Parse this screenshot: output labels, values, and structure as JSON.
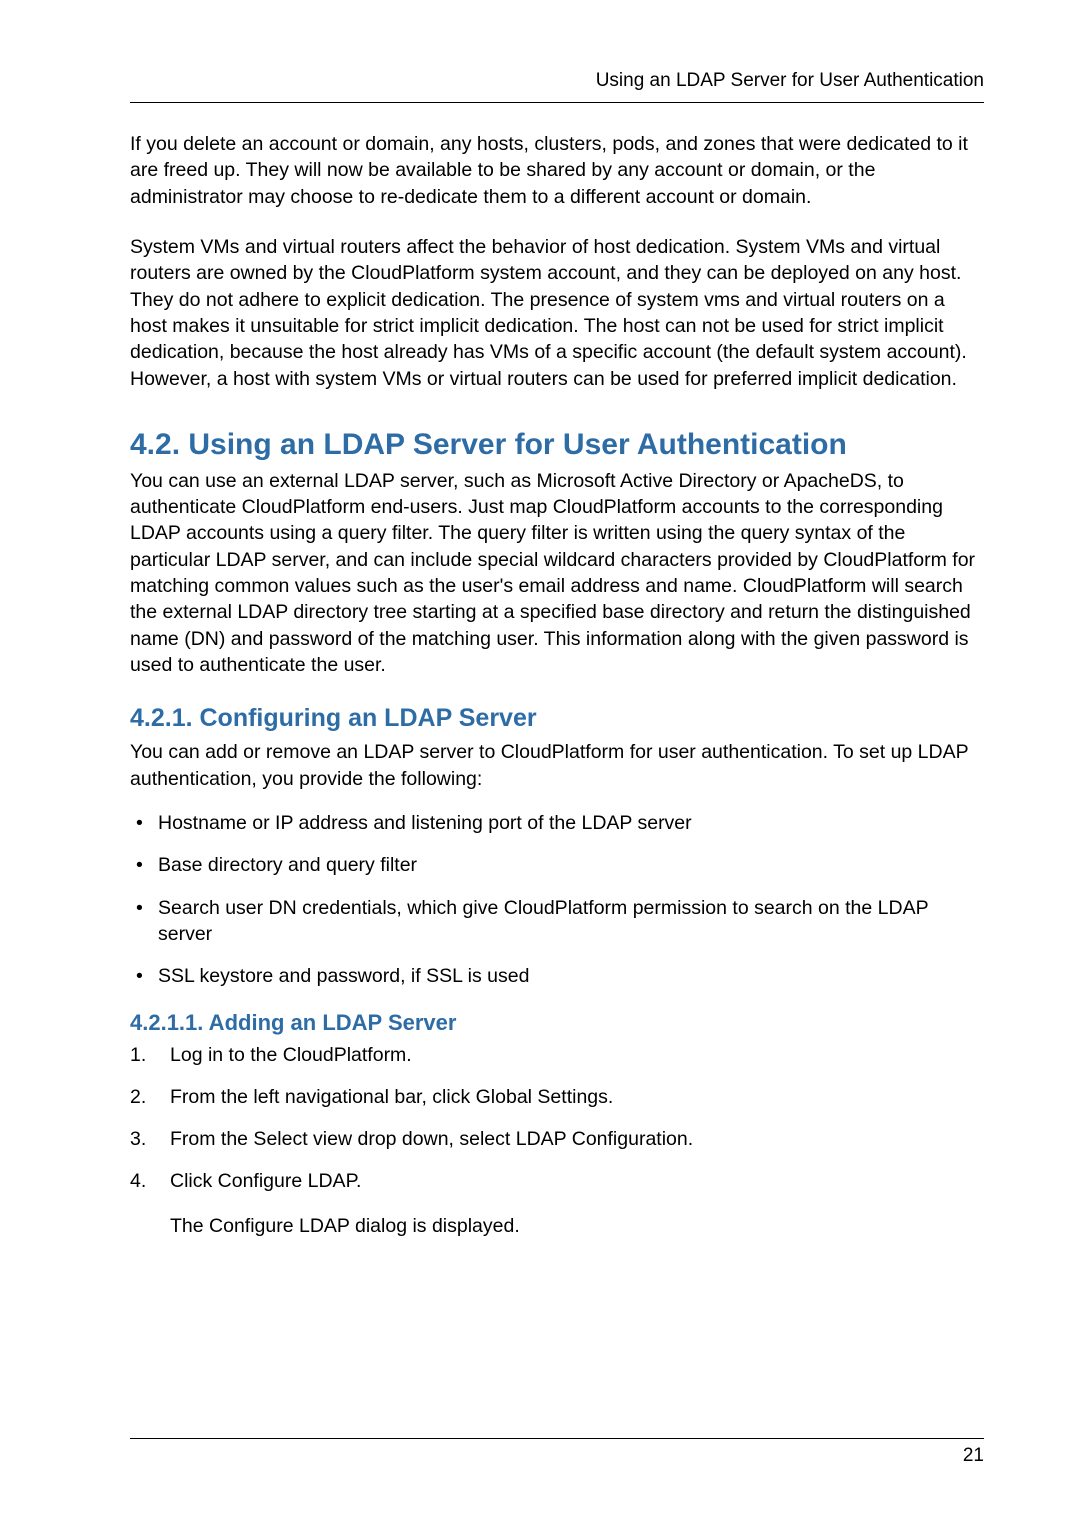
{
  "header": {
    "running_title": "Using an LDAP Server for User Authentication"
  },
  "intro": {
    "para1": "If you delete an account or domain, any hosts, clusters, pods, and zones that were dedicated to it are freed up. They will now be available to be shared by any account or domain, or the administrator may choose to re-dedicate them to a different account or domain.",
    "para2": "System VMs and virtual routers affect the behavior of host dedication. System VMs and virtual routers are owned by the CloudPlatform system account, and they can be deployed on any host. They do not adhere to explicit dedication. The presence of system vms and virtual routers on a host makes it unsuitable for strict implicit dedication. The host can not be used for strict implicit dedication, because the host already has VMs of a specific account (the default system account). However, a host with system VMs or virtual routers can be used for preferred implicit dedication."
  },
  "section42": {
    "title": "4.2. Using an LDAP Server for User Authentication",
    "para": "You can use an external LDAP server, such as Microsoft Active Directory or ApacheDS, to authenticate CloudPlatform end-users. Just map CloudPlatform accounts to the corresponding LDAP accounts using a query filter. The query filter is written using the query syntax of the particular LDAP server, and can include special wildcard characters provided by CloudPlatform for matching common values such as the user's email address and name. CloudPlatform will search the external LDAP directory tree starting at a specified base directory and return the distinguished name (DN) and password of the matching user. This information along with the given password is used to authenticate the user."
  },
  "section421": {
    "title": "4.2.1. Configuring an LDAP Server",
    "para": "You can add or remove an LDAP server to CloudPlatform for user authentication. To set up LDAP authentication, you provide the following:",
    "bullets": [
      "Hostname or IP address and listening port of the LDAP server",
      "Base directory and query filter",
      "Search user DN credentials, which give CloudPlatform permission to search on the LDAP server",
      "SSL keystore and password, if SSL is used"
    ]
  },
  "section4211": {
    "title": "4.2.1.1. Adding an LDAP Server",
    "steps": [
      {
        "text": "Log in to the CloudPlatform."
      },
      {
        "text": "From the left navigational bar, click Global Settings."
      },
      {
        "text": "From the Select view drop down, select LDAP Configuration."
      },
      {
        "text": "Click Configure LDAP.",
        "note": "The Configure LDAP dialog is displayed."
      }
    ]
  },
  "footer": {
    "page_number": "21"
  }
}
